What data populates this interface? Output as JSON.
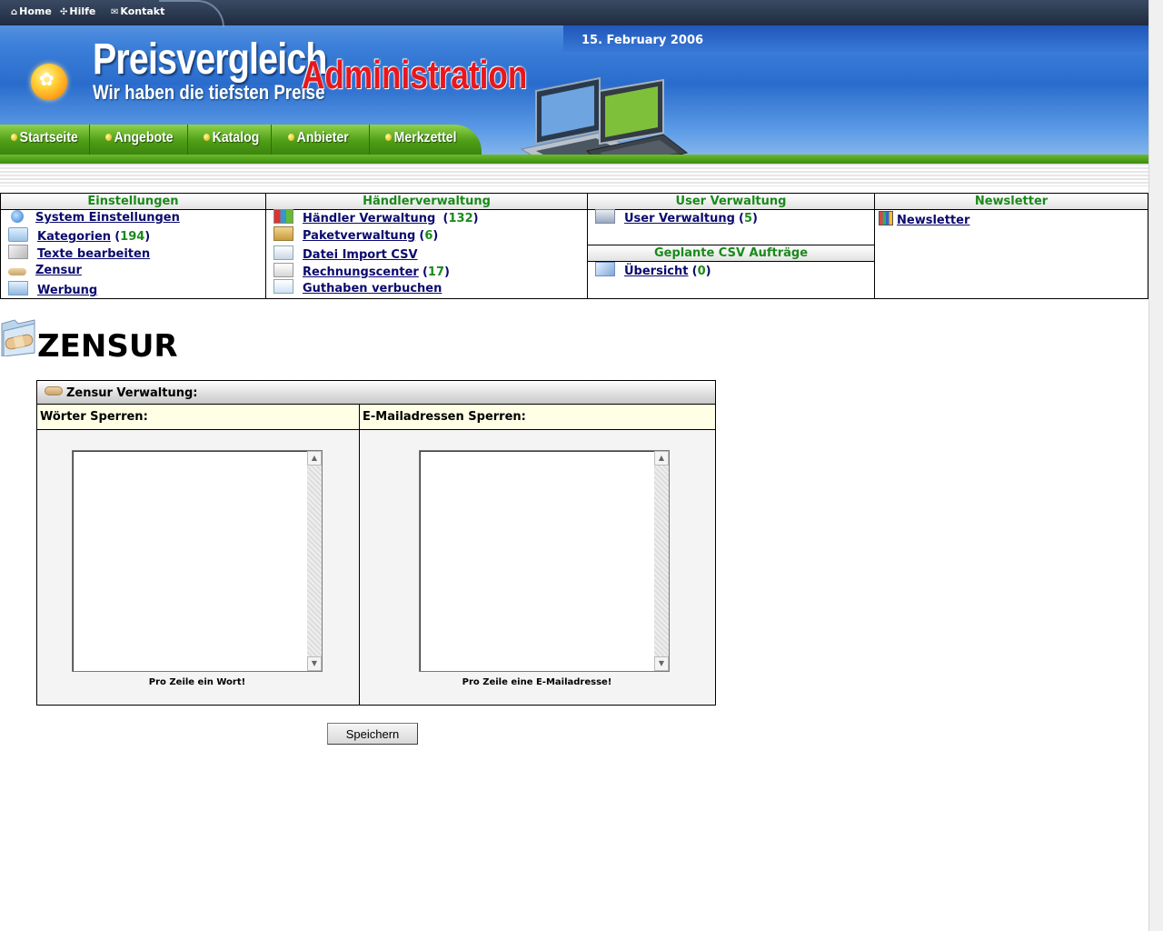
{
  "topbar": {
    "home": "Home",
    "help": "Hilfe",
    "contact": "Kontakt"
  },
  "header": {
    "date": "15. February 2006",
    "logo_line1": "Preisvergleich",
    "logo_line2": "Wir haben die tiefsten Preise",
    "logo_overlay": "Administration"
  },
  "nav": {
    "items": [
      "Startseite",
      "Angebote",
      "Katalog",
      "Anbieter",
      "Merkzettel"
    ]
  },
  "admin_menu": {
    "einstellungen": {
      "title": "Einstellungen",
      "items": [
        {
          "label": "System Einstellungen",
          "icon": "globe-icon"
        },
        {
          "label": "Kategorien",
          "count": "194",
          "icon": "folder-icon"
        },
        {
          "label": "Texte bearbeiten",
          "icon": "pen-icon"
        },
        {
          "label": "Zensur",
          "icon": "bandage-icon"
        },
        {
          "label": "Werbung",
          "icon": "ad-icon"
        }
      ]
    },
    "haendler": {
      "title": "Händlerverwaltung",
      "items": [
        {
          "label": "Händler Verwaltung",
          "count": "132",
          "icon": "blocks-icon"
        },
        {
          "label": "Paketverwaltung",
          "count": "6",
          "icon": "package-icon"
        },
        {
          "label": "Datei Import CSV",
          "icon": "import-icon"
        },
        {
          "label": "Rechnungscenter",
          "count": "17",
          "icon": "document-icon"
        },
        {
          "label": "Guthaben verbuchen",
          "icon": "plus-icon"
        }
      ]
    },
    "user": {
      "title": "User Verwaltung",
      "items": [
        {
          "label": "User Verwaltung",
          "count": "5",
          "icon": "user-icon"
        }
      ]
    },
    "csv": {
      "title": "Geplante CSV Aufträge",
      "items": [
        {
          "label": "Übersicht",
          "count": "0",
          "icon": "overview-icon"
        }
      ]
    },
    "newsletter": {
      "title": "Newsletter",
      "items": [
        {
          "label": "Newsletter",
          "icon": "newsletter-icon"
        }
      ]
    }
  },
  "page": {
    "title": "ZENSUR"
  },
  "zensur_panel": {
    "title": "Zensur Verwaltung:",
    "words_header": "Wörter Sperren:",
    "emails_header": "E-Mailadressen Sperren:",
    "words_value": "",
    "emails_value": "",
    "words_hint": "Pro Zeile ein Wort!",
    "emails_hint": "Pro Zeile eine E-Mailadresse!",
    "save_label": "Speichern"
  }
}
